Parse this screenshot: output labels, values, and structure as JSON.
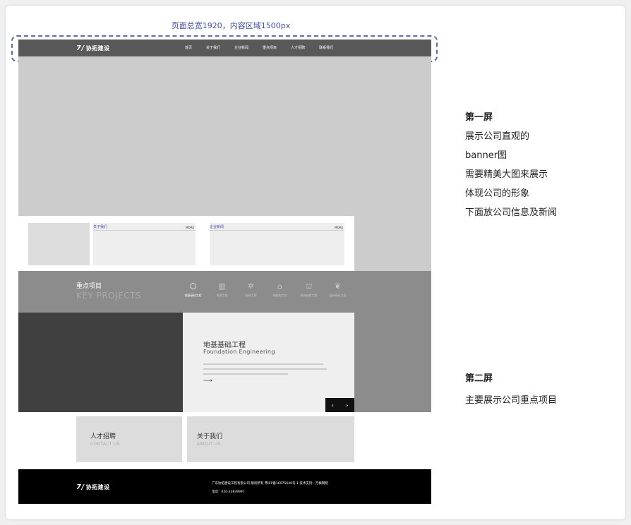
{
  "top_note": "页面总宽1920，内容区域1500px",
  "nav": {
    "logo": "协拓建设",
    "items": [
      "首页",
      "关于我们",
      "企业新闻",
      "重点项目",
      "人才招聘",
      "联系我们"
    ]
  },
  "info": {
    "about_title": "关于我们",
    "about_more": "MORE",
    "news_title": "企业新闻",
    "news_more": "MORE"
  },
  "key_projects": {
    "title": "重点项目",
    "title_en": "KEY PROJECTS",
    "icons": [
      {
        "icon": "building-cube-icon",
        "label": "地基基础工程"
      },
      {
        "icon": "tower-icon",
        "label": "房建工程"
      },
      {
        "icon": "gear-icon",
        "label": "市政工程"
      },
      {
        "icon": "bridge-icon",
        "label": "钢结构工程"
      },
      {
        "icon": "temple-icon",
        "label": "装饰装修工程"
      },
      {
        "icon": "leaf-icon",
        "label": "园林绿化工程"
      }
    ]
  },
  "project": {
    "title": "地基基础工程",
    "title_en": "Foundation Engineering"
  },
  "bottom_cards": [
    {
      "title": "人才招聘",
      "subtitle": "CONTACT US"
    },
    {
      "title": "关于我们",
      "subtitle": "ABOUT US"
    }
  ],
  "footer": {
    "logo": "协拓建设",
    "copyright": "广东协拓建设工程有限公司 版权所有  粤ICP备16075640号-1 技术支持：万枫网络",
    "phone": "电话：020-23839997"
  },
  "annotations": {
    "screen1": [
      "第一屏",
      "展示公司直观的",
      "banner图",
      "需要精美大图来展示",
      "体现公司的形象",
      "下面放公司信息及新闻"
    ],
    "screen2": [
      "第二屏",
      "主要展示公司重点项目"
    ]
  }
}
